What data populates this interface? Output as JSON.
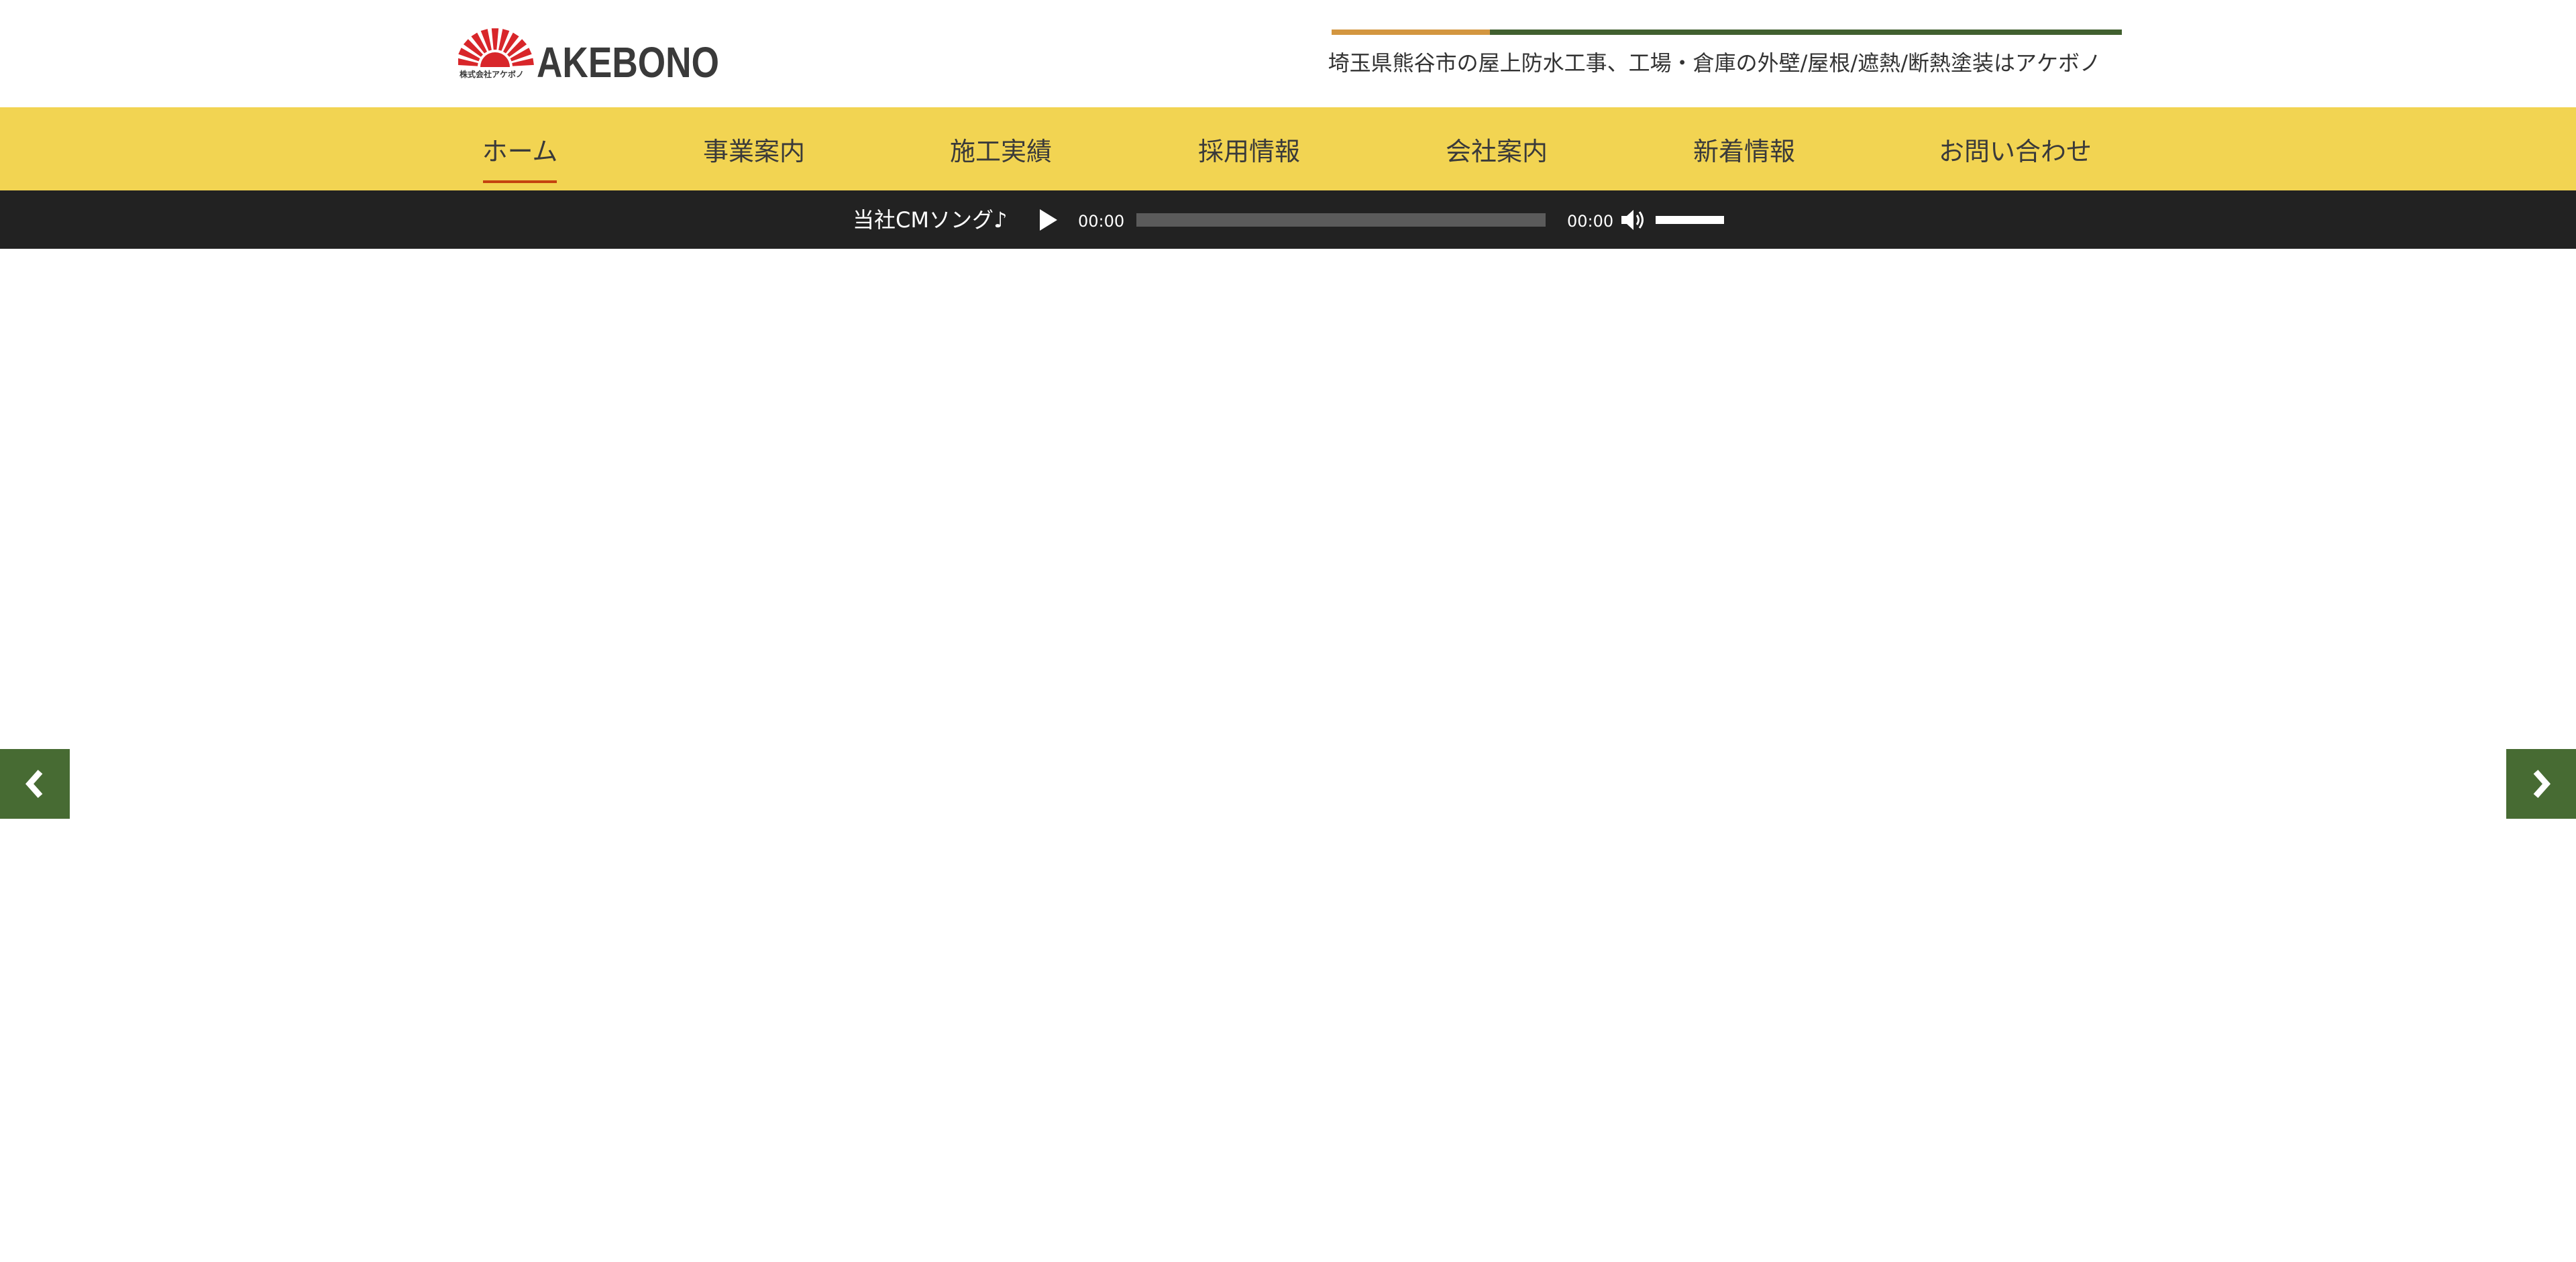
{
  "colors": {
    "nav_background": "#f2d452",
    "nav_active": "#c4420f",
    "audio_bar_background": "#222222",
    "brand_red": "#d8262a",
    "brand_dark": "#3a3a3a",
    "rule_orange": "#d39640",
    "rule_green": "#41602f",
    "arrow_green": "#476b33"
  },
  "header": {
    "logo": {
      "small_text": "株式会社アケボノ",
      "wordmark": "AKEBONO",
      "icon": "rising-sun-icon"
    },
    "tagline": "埼玉県熊谷市の屋上防水工事、工場・倉庫の外壁/屋根/遮熱/断熱塗装はアケボノ"
  },
  "nav": {
    "items": [
      {
        "label": "ホーム",
        "active": true
      },
      {
        "label": "事業案内",
        "active": false
      },
      {
        "label": "施工実績",
        "active": false
      },
      {
        "label": "採用情報",
        "active": false
      },
      {
        "label": "会社案内",
        "active": false
      },
      {
        "label": "新着情報",
        "active": false
      },
      {
        "label": "お問い合わせ",
        "active": false
      }
    ]
  },
  "audio": {
    "title": "当社CMソング♪",
    "current_time": "00:00",
    "duration": "00:00",
    "progress": 0,
    "volume": 1.0,
    "play_icon": "play-icon",
    "volume_icon": "speaker-icon"
  },
  "slider": {
    "prev_icon": "chevron-left-icon",
    "next_icon": "chevron-right-icon"
  }
}
